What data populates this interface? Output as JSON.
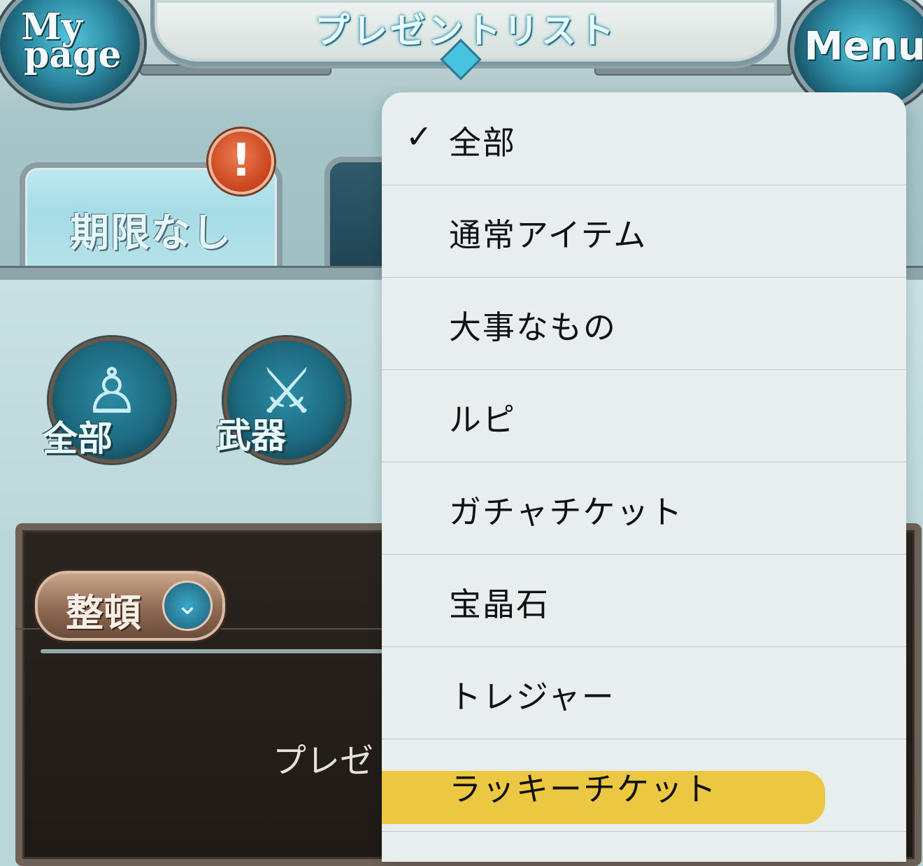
{
  "header": {
    "title": "プレゼントリスト",
    "mypage_line1": "My",
    "mypage_line2": "page",
    "menu_label": "Menu"
  },
  "tabs": {
    "active_label": "期限なし",
    "alert_symbol": "!"
  },
  "categories": [
    {
      "label": "全部",
      "icon": "character-crystal-icon"
    },
    {
      "label": "武器",
      "icon": "sword-icon"
    }
  ],
  "panel": {
    "sort_label": "整頓",
    "sort_icon": "double-chevron-down-icon",
    "empty_text_visible": "プレゼ"
  },
  "dropdown": {
    "selected_index": 0,
    "check_glyph": "✓",
    "items": [
      "全部",
      "通常アイテム",
      "大事なもの",
      "ルピ",
      "ガチャチケット",
      "宝晶石",
      "トレジャー",
      "ラッキーチケット"
    ],
    "highlighted_item": "ラッキーチケット",
    "highlight_color": "#ecc22d"
  },
  "colors": {
    "accent_cyan": "#2c8aa2",
    "panel_dark": "#221c18",
    "badge_red": "#c8441d"
  }
}
